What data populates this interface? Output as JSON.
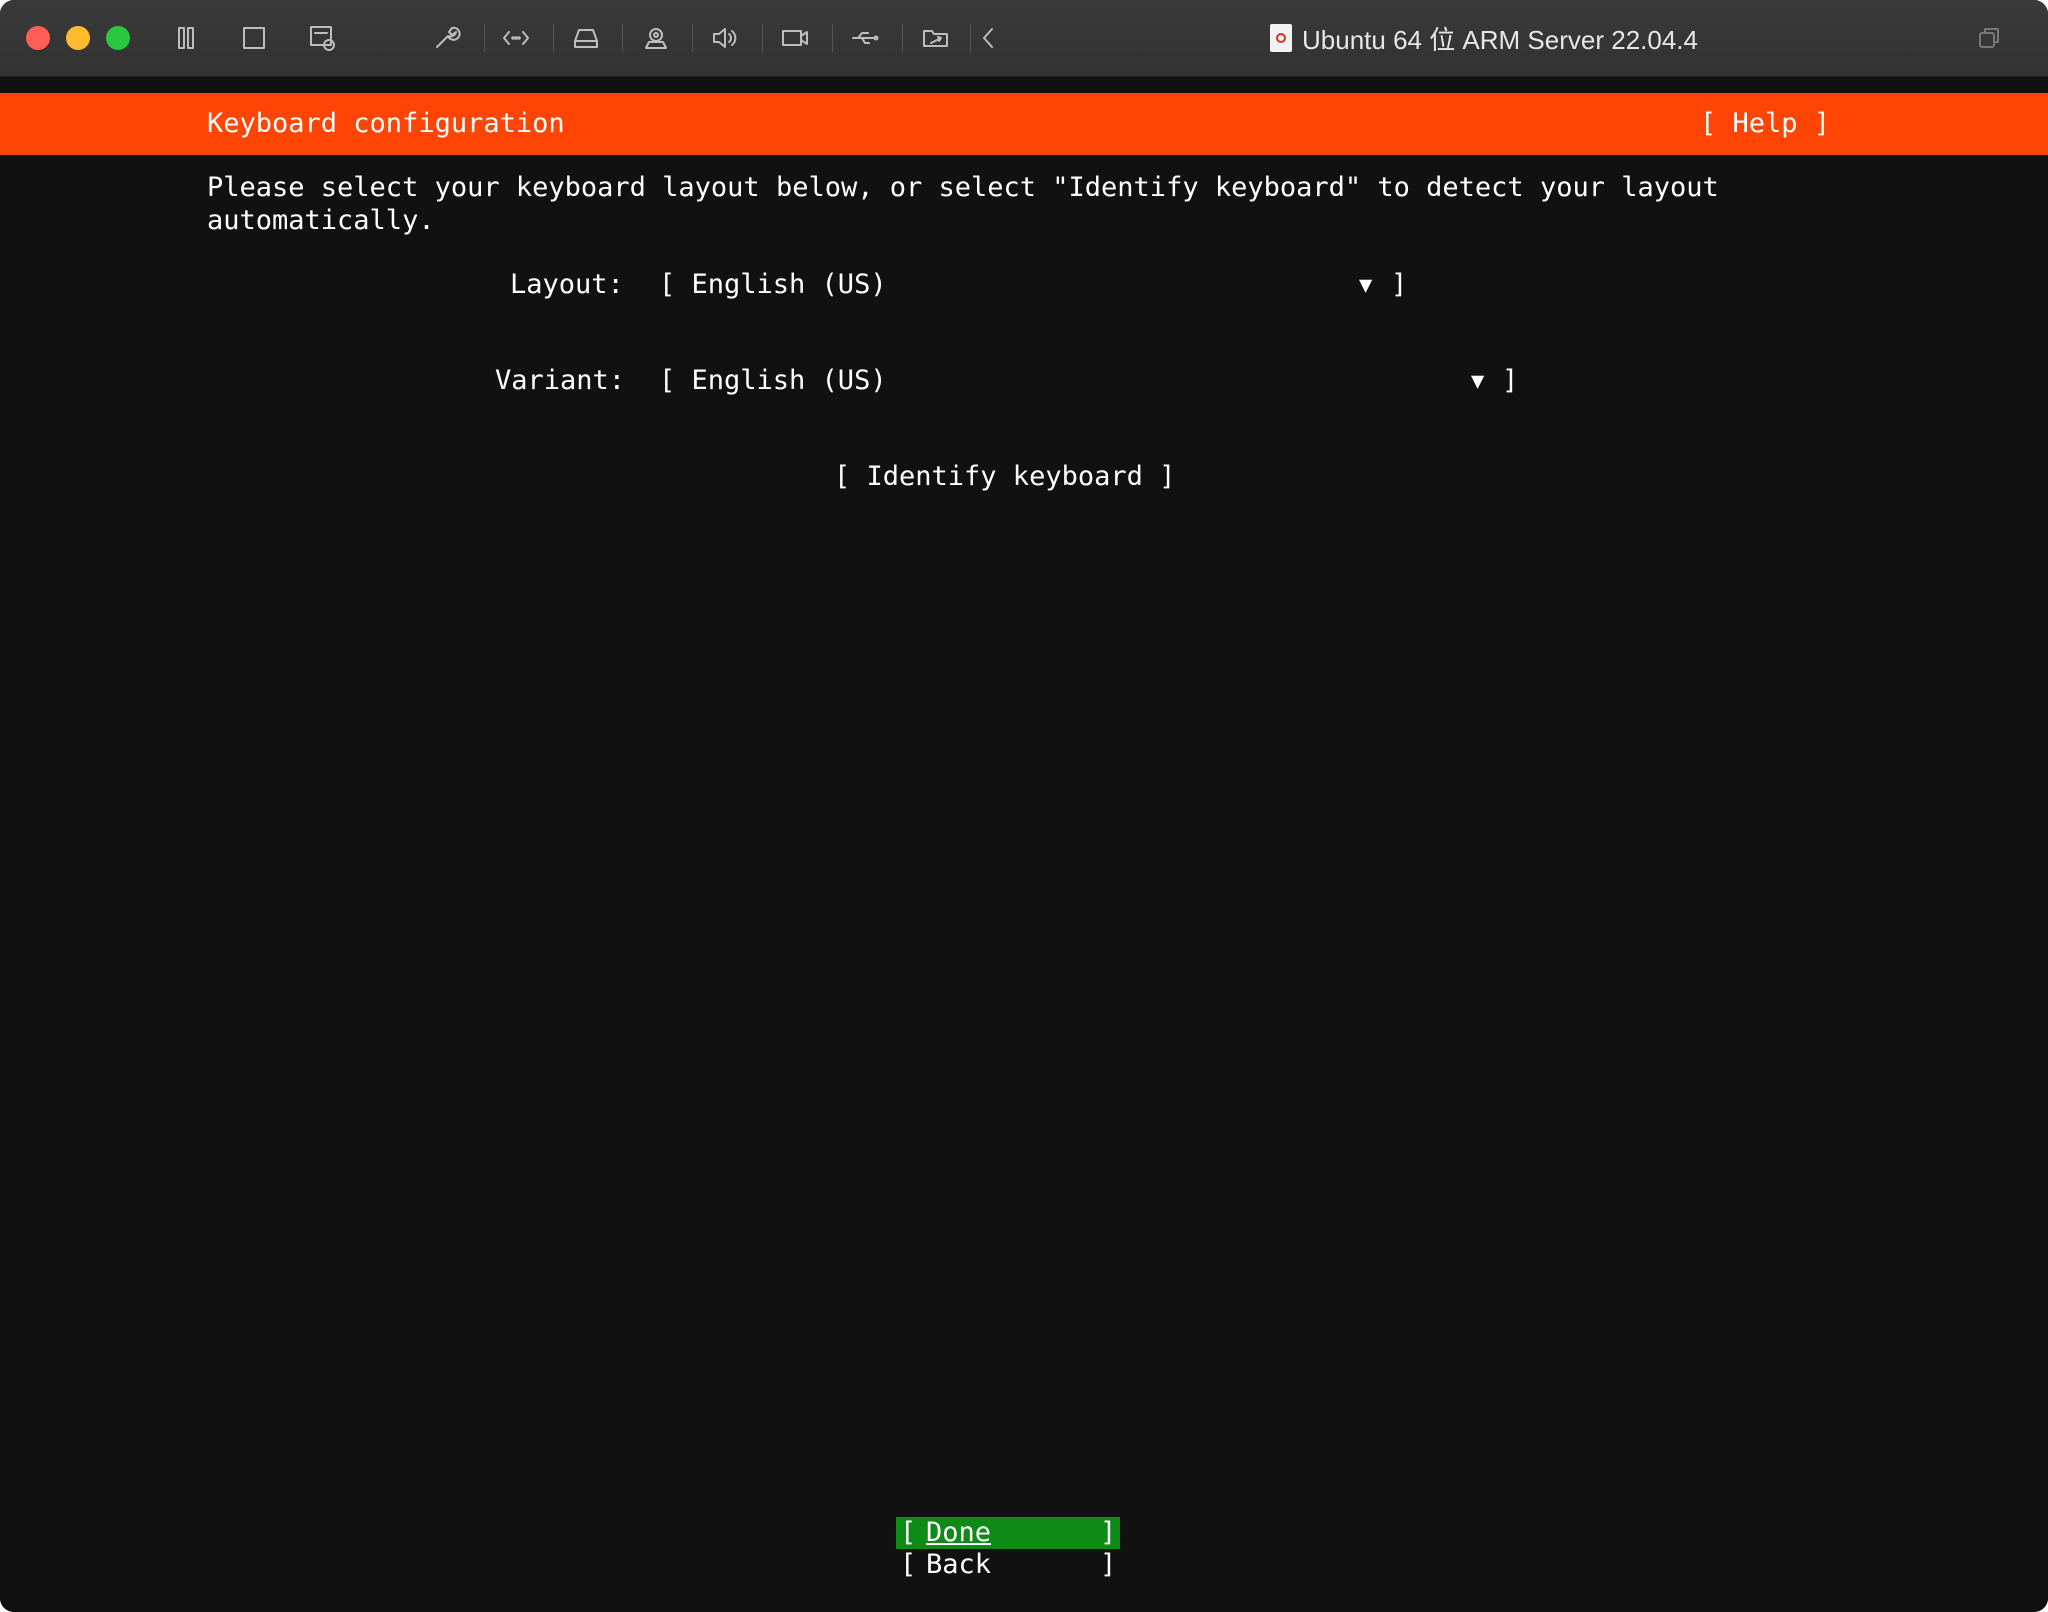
{
  "window": {
    "title": "Ubuntu 64 位 ARM Server 22.04.4",
    "toolbar_icons": [
      "pause-icon",
      "stop-icon",
      "snapshot-icon",
      "settings-wrench-icon",
      "network-icon",
      "hard-disk-icon",
      "camera-icon",
      "sound-icon",
      "video-camera-icon",
      "usb-icon",
      "shared-folder-icon",
      "chevron-left-icon",
      "window-restore-icon"
    ]
  },
  "installer": {
    "header_title": "Keyboard configuration",
    "help_label": "[ Help ]",
    "intro_line1": "Please select your keyboard layout below, or select \"Identify keyboard\" to detect your layout",
    "intro_line2": "automatically.",
    "layout_label": "Layout:",
    "layout_value": "[ English (US)",
    "variant_label": "Variant:",
    "variant_value": "[ English (US)",
    "dropdown_arrow": "▼",
    "close_bracket": "]",
    "identify_button": "[ Identify keyboard ]",
    "done_label": "Done",
    "back_label": "Back",
    "open_bracket": "["
  },
  "colors": {
    "header_bg": "#ff4506",
    "done_bg": "#0e8a16",
    "screen_bg": "#111111"
  }
}
